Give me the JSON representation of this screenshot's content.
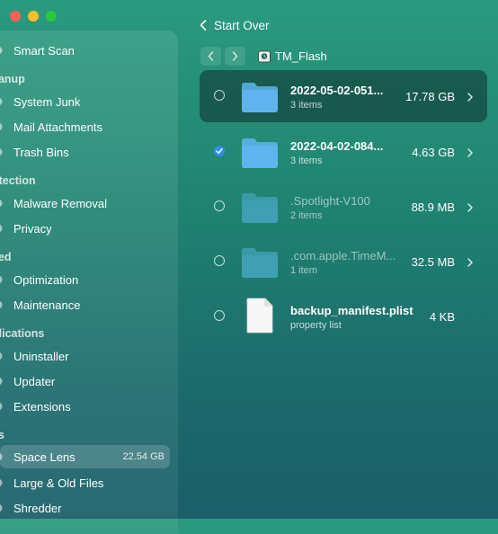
{
  "sidebar": {
    "items": [
      {
        "kind": "item",
        "label": "Smart Scan",
        "icon": "smart-scan-icon"
      },
      {
        "kind": "section",
        "label": "eanup"
      },
      {
        "kind": "item",
        "label": "System Junk",
        "icon": "system-junk-icon"
      },
      {
        "kind": "item",
        "label": "Mail Attachments",
        "icon": "mail-attachments-icon"
      },
      {
        "kind": "item",
        "label": "Trash Bins",
        "icon": "trash-bins-icon"
      },
      {
        "kind": "section",
        "label": "otection"
      },
      {
        "kind": "item",
        "label": "Malware Removal",
        "icon": "malware-removal-icon"
      },
      {
        "kind": "item",
        "label": "Privacy",
        "icon": "privacy-icon"
      },
      {
        "kind": "section",
        "label": "eed"
      },
      {
        "kind": "item",
        "label": "Optimization",
        "icon": "optimization-icon"
      },
      {
        "kind": "item",
        "label": "Maintenance",
        "icon": "maintenance-icon"
      },
      {
        "kind": "section",
        "label": "plications"
      },
      {
        "kind": "item",
        "label": "Uninstaller",
        "icon": "uninstaller-icon"
      },
      {
        "kind": "item",
        "label": "Updater",
        "icon": "updater-icon"
      },
      {
        "kind": "item",
        "label": "Extensions",
        "icon": "extensions-icon"
      },
      {
        "kind": "section",
        "label": "es"
      },
      {
        "kind": "item",
        "label": "Space Lens",
        "icon": "space-lens-icon",
        "selected": true,
        "size": "22.54 GB"
      },
      {
        "kind": "item",
        "label": "Large & Old Files",
        "icon": "large-old-files-icon"
      },
      {
        "kind": "item",
        "label": "Shredder",
        "icon": "shredder-icon"
      }
    ]
  },
  "topbar": {
    "back_label": "Start Over"
  },
  "path": {
    "current": "TM_Flash"
  },
  "files": [
    {
      "name": "2022-05-02-051...",
      "sub": "3 items",
      "size": "17.78 GB",
      "type": "folder",
      "checked": false,
      "active": true,
      "dim": false
    },
    {
      "name": "2022-04-02-084...",
      "sub": "3 items",
      "size": "4.63 GB",
      "type": "folder",
      "checked": true,
      "active": false,
      "dim": false
    },
    {
      "name": ".Spotlight-V100",
      "sub": "2 items",
      "size": "88.9 MB",
      "type": "folder",
      "checked": false,
      "active": false,
      "dim": true
    },
    {
      "name": ".com.apple.TimeM...",
      "sub": "1 item",
      "size": "32.5 MB",
      "type": "folder",
      "checked": false,
      "active": false,
      "dim": true
    },
    {
      "name": "backup_manifest.plist",
      "sub": "property list",
      "size": "4 KB",
      "type": "document",
      "checked": false,
      "active": false,
      "dim": false
    }
  ],
  "colors": {
    "accent_check": "#2f8ff0",
    "folder": "#5fb4ee",
    "folder_dim": "#3f9fb3"
  }
}
